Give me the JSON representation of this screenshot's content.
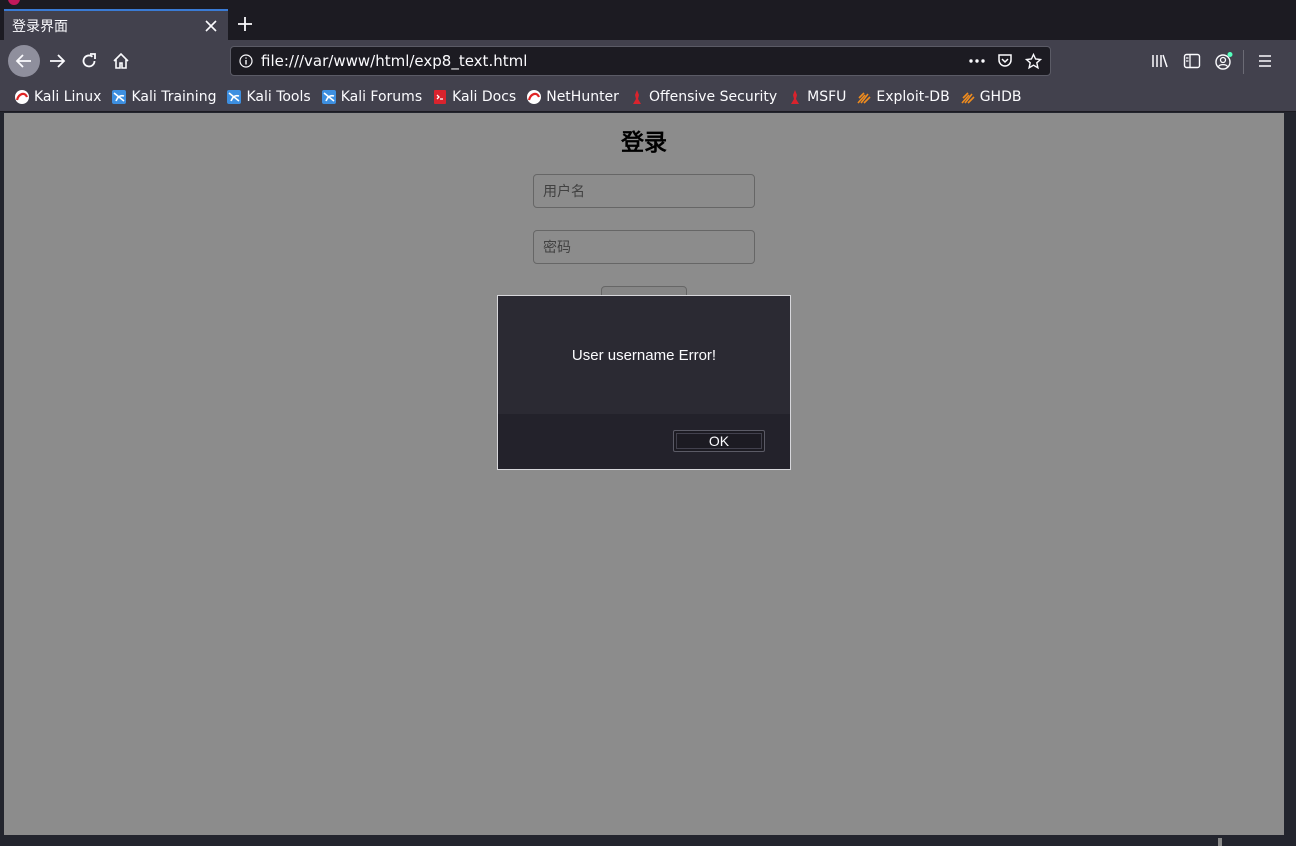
{
  "browser": {
    "tab": {
      "title": "登录界面"
    },
    "url": "file:///var/www/html/exp8_text.html",
    "bookmarks": [
      {
        "label": "Kali Linux",
        "icon": "kali-dragon-icon"
      },
      {
        "label": "Kali Training",
        "icon": "kali-training-icon"
      },
      {
        "label": "Kali Tools",
        "icon": "kali-tools-icon"
      },
      {
        "label": "Kali Forums",
        "icon": "kali-forums-icon"
      },
      {
        "label": "Kali Docs",
        "icon": "kali-docs-icon"
      },
      {
        "label": "NetHunter",
        "icon": "nethunter-icon"
      },
      {
        "label": "Offensive Security",
        "icon": "offsec-icon"
      },
      {
        "label": "MSFU",
        "icon": "msfu-icon"
      },
      {
        "label": "Exploit-DB",
        "icon": "exploit-db-icon"
      },
      {
        "label": "GHDB",
        "icon": "ghdb-icon"
      }
    ]
  },
  "page": {
    "title": "登录",
    "username_placeholder": "用户名",
    "password_placeholder": "密码"
  },
  "dialog": {
    "message": "User username Error!",
    "ok_label": "OK"
  },
  "colors": {
    "tab_accent": "#3a7bd5",
    "toolbar": "#42414d",
    "dialog_bg": "#2b2a33"
  }
}
